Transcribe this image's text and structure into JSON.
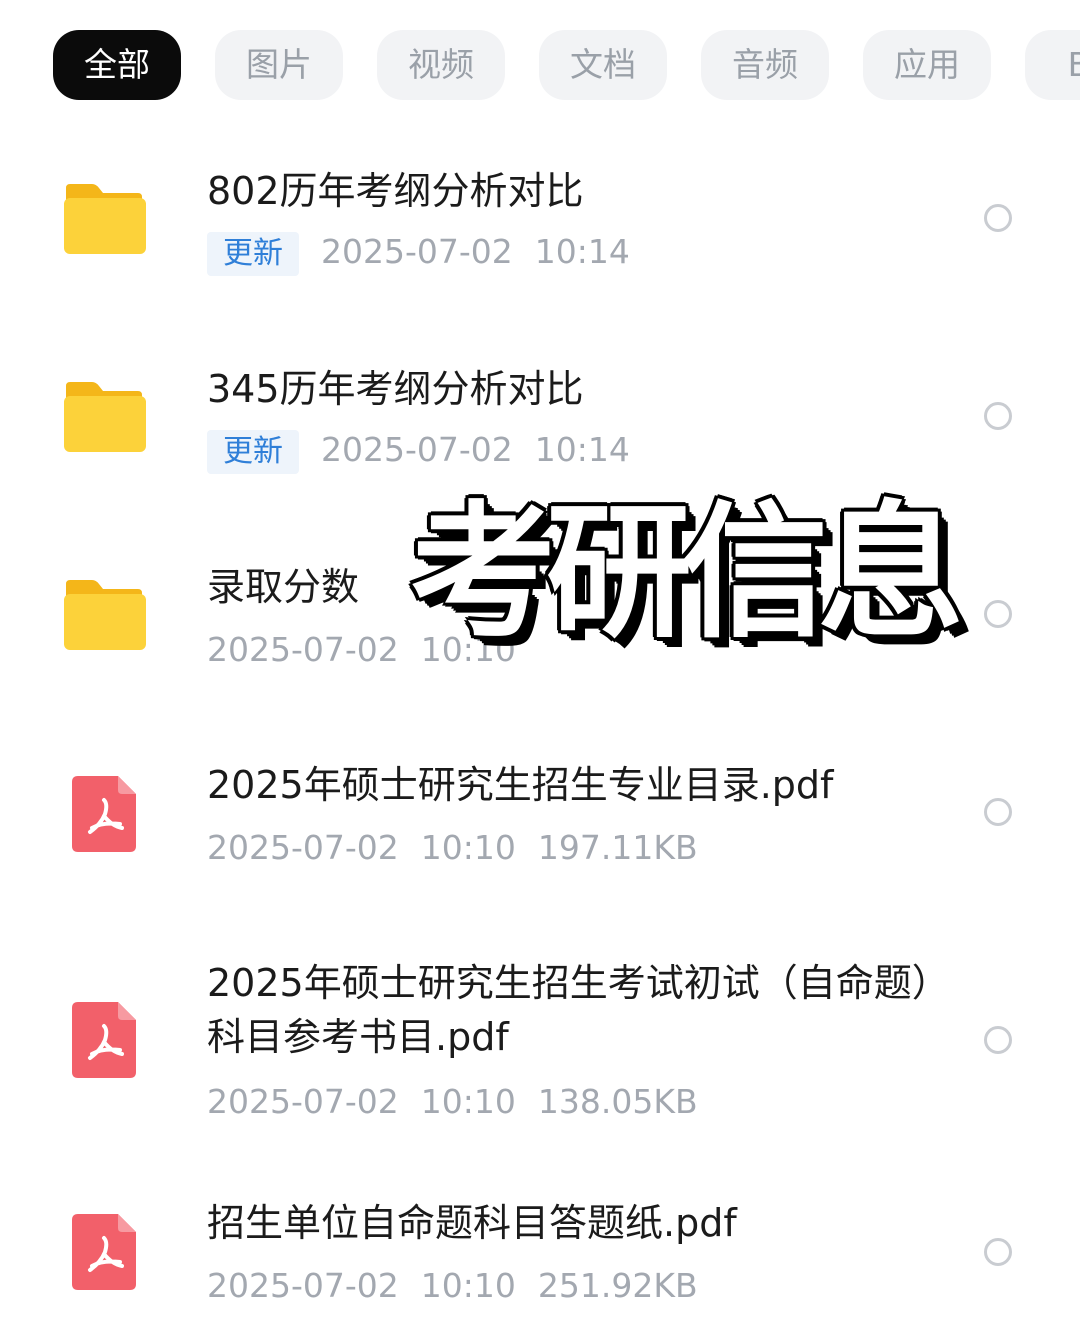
{
  "tabs": [
    {
      "label": "全部",
      "active": true
    },
    {
      "label": "图片",
      "active": false
    },
    {
      "label": "视频",
      "active": false
    },
    {
      "label": "文档",
      "active": false
    },
    {
      "label": "音频",
      "active": false
    },
    {
      "label": "应用",
      "active": false
    },
    {
      "label": "BT",
      "active": false
    }
  ],
  "files": [
    {
      "icon": "folder-icon",
      "name": "802历年考纲分析对比",
      "badge": "更新",
      "date": "2025-07-02",
      "time": "10:14",
      "size": ""
    },
    {
      "icon": "folder-icon",
      "name": "345历年考纲分析对比",
      "badge": "更新",
      "date": "2025-07-02",
      "time": "10:14",
      "size": ""
    },
    {
      "icon": "folder-icon",
      "name": "录取分数",
      "badge": "",
      "date": "2025-07-02",
      "time": "10:10",
      "size": ""
    },
    {
      "icon": "pdf-icon",
      "name": "2025年硕士研究生招生专业目录.pdf",
      "badge": "",
      "date": "2025-07-02",
      "time": "10:10",
      "size": "197.11KB"
    },
    {
      "icon": "pdf-icon",
      "name": "2025年硕士研究生招生考试初试（自命题）科目参考书目.pdf",
      "badge": "",
      "date": "2025-07-02",
      "time": "10:10",
      "size": "138.05KB"
    },
    {
      "icon": "pdf-icon",
      "name": "招生单位自命题科目答题纸.pdf",
      "badge": "",
      "date": "2025-07-02",
      "time": "10:10",
      "size": "251.92KB"
    }
  ],
  "overlay_text": "考研信息",
  "colors": {
    "accent_blue": "#2f7fd8",
    "folder_yellow": "#fbcf2a",
    "pdf_red": "#f2606a",
    "active_tab": "#0b0b0b"
  }
}
